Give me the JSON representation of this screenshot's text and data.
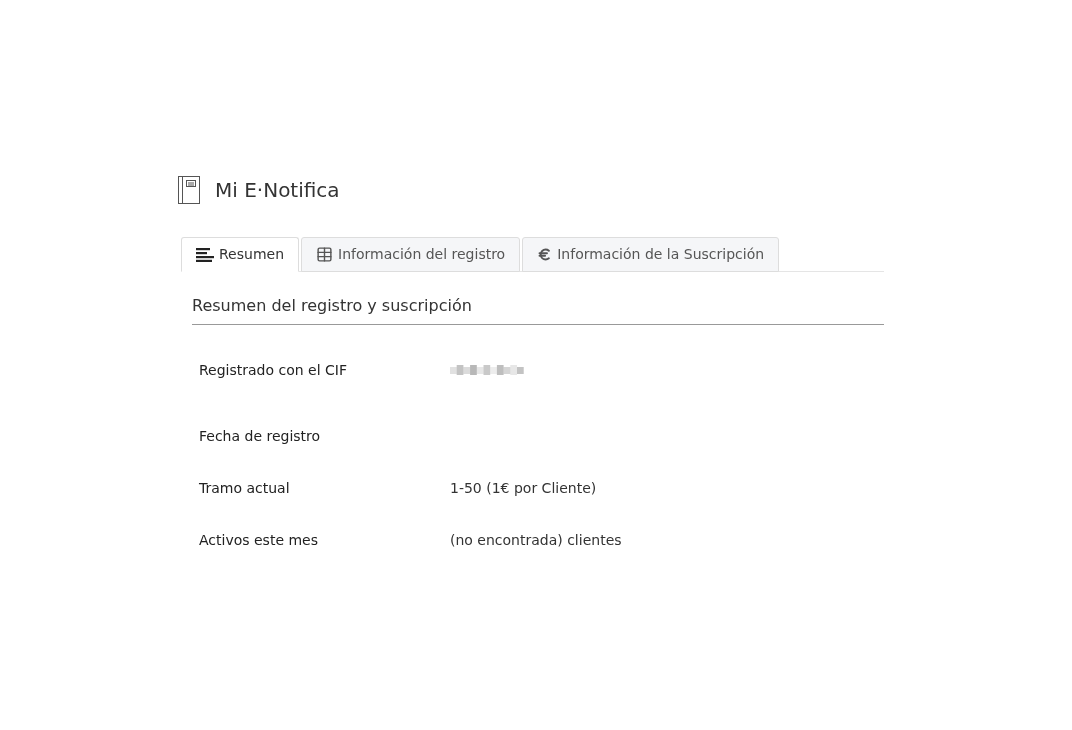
{
  "header": {
    "title": "Mi E·Notifica"
  },
  "tabs": [
    {
      "label": "Resumen",
      "selected": true
    },
    {
      "label": "Información del registro",
      "selected": false
    },
    {
      "label": "Información de la Suscripción",
      "selected": false
    }
  ],
  "section": {
    "title": "Resumen del registro y suscripción"
  },
  "rows": [
    {
      "label": "Registrado con el CIF",
      "value": {
        "kind": "redacted"
      }
    },
    {
      "label": "Fecha de registro"
    },
    {
      "label": "Tramo actual",
      "value": {
        "kind": "text",
        "text": "1-50 (1€ por Cliente)"
      }
    },
    {
      "label": "Activos este mes",
      "value": {
        "kind": "text",
        "text": "(no encontrada) clientes"
      }
    }
  ]
}
